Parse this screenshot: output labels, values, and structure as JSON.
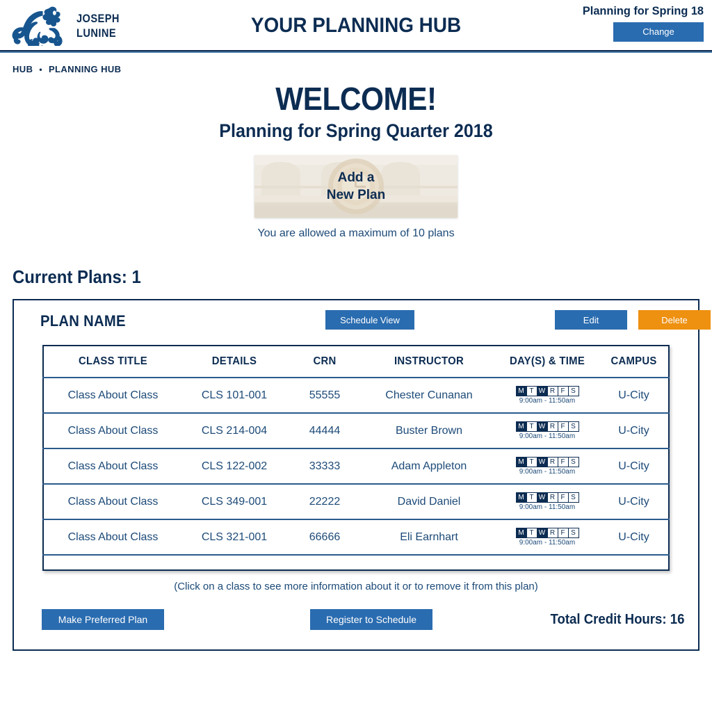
{
  "header": {
    "brand_name": "JOSEPH\nLUNINE",
    "logo_icon": "dragon-logo-icon",
    "title": "YOUR PLANNING HUB",
    "term_label": "Planning for Spring 18",
    "change_button": "Change"
  },
  "breadcrumb": {
    "items": [
      "HUB",
      "PLANNING HUB"
    ],
    "separator": "•"
  },
  "welcome": {
    "title": "WELCOME!",
    "subtitle": "Planning for Spring Quarter 2018"
  },
  "add_plan": {
    "line1": "Add a",
    "line2": "New Plan",
    "max_note": "You are allowed a maximum of 10 plans"
  },
  "current_plans": {
    "heading": "Current Plans: 1"
  },
  "plan": {
    "name": "PLAN NAME",
    "schedule_view_button": "Schedule View",
    "edit_button": "Edit",
    "delete_button": "Delete",
    "hint": "(Click on a class to see more information about it or to remove it from this plan)",
    "make_preferred_button": "Make Preferred Plan",
    "register_button": "Register to Schedule",
    "total_credit_hours": "Total Credit Hours: 16"
  },
  "table": {
    "columns": [
      "CLASS TITLE",
      "DETAILS",
      "CRN",
      "INSTRUCTOR",
      "DAY(S) & TIME",
      "CAMPUS"
    ],
    "day_letters": [
      "M",
      "T",
      "W",
      "R",
      "F",
      "S"
    ],
    "rows": [
      {
        "title": "Class About Class",
        "details": "CLS 101-001",
        "crn": "55555",
        "instructor": "Chester Cunanan",
        "days": [
          true,
          false,
          true,
          false,
          false,
          false
        ],
        "time": "9:00am - 11:50am",
        "campus": "U-City"
      },
      {
        "title": "Class About Class",
        "details": "CLS 214-004",
        "crn": "44444",
        "instructor": "Buster Brown",
        "days": [
          true,
          false,
          true,
          false,
          false,
          false
        ],
        "time": "9:00am - 11:50am",
        "campus": "U-City"
      },
      {
        "title": "Class About Class",
        "details": "CLS 122-002",
        "crn": "33333",
        "instructor": "Adam Appleton",
        "days": [
          true,
          false,
          true,
          false,
          false,
          false
        ],
        "time": "9:00am - 11:50am",
        "campus": "U-City"
      },
      {
        "title": "Class About Class",
        "details": "CLS 349-001",
        "crn": "22222",
        "instructor": "David Daniel",
        "days": [
          true,
          false,
          true,
          false,
          false,
          false
        ],
        "time": "9:00am - 11:50am",
        "campus": "U-City"
      },
      {
        "title": "Class About Class",
        "details": "CLS 321-001",
        "crn": "66666",
        "instructor": "Eli Earnhart",
        "days": [
          true,
          false,
          true,
          false,
          false,
          false
        ],
        "time": "9:00am - 11:50am",
        "campus": "U-City"
      }
    ]
  },
  "colors": {
    "navy": "#0c2c52",
    "blue_button": "#2a6cb0",
    "orange_button": "#ee9010",
    "rule_light": "#4f7da8",
    "body_text": "#1c4a78"
  }
}
